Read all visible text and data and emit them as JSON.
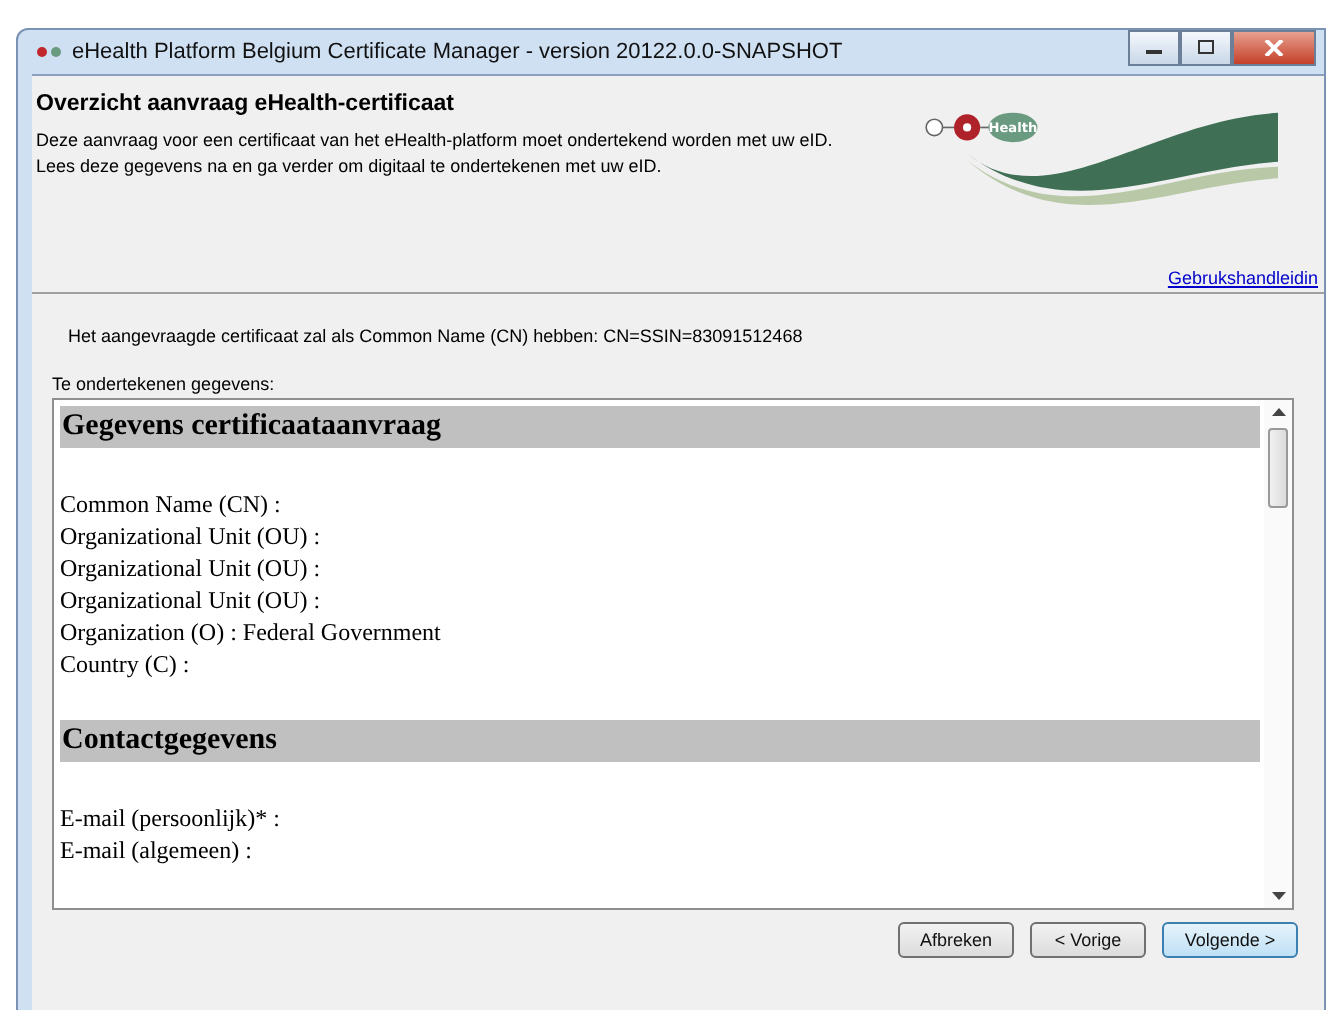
{
  "window": {
    "title": "eHealth Platform Belgium Certificate Manager - version 20122.0.0-SNAPSHOT"
  },
  "header": {
    "title": "Overzicht aanvraag eHealth-certificaat",
    "lines": [
      "Deze aanvraag voor een certificaat van het eHealth-platform moet ondertekend worden met uw eID.",
      "Lees deze gegevens na en ga verder om digitaal te ondertekenen met uw eID."
    ],
    "logo_text": "Health",
    "help_link": "Gebrukshandleidin"
  },
  "cn_notice": "Het aangevraagde certificaat zal als Common Name (CN) hebben:  CN=SSIN=83091512468",
  "document_label": "Te ondertekenen gegevens:",
  "document": {
    "sections": [
      {
        "heading": "Gegevens certificaataanvraag",
        "lines": [
          "Common Name (CN) :",
          "Organizational Unit (OU) :",
          "Organizational Unit (OU) :",
          "Organizational Unit (OU) :",
          "Organization (O) : Federal Government",
          "Country (C) :"
        ]
      },
      {
        "heading": "Contactgegevens",
        "lines": [
          "E-mail (persoonlijk)* :",
          "E-mail (algemeen) :"
        ]
      }
    ]
  },
  "buttons": [
    {
      "label": "Afbreken",
      "focused": false
    },
    {
      "label": "< Vorige",
      "focused": false
    },
    {
      "label": "Volgende >",
      "focused": true
    }
  ]
}
